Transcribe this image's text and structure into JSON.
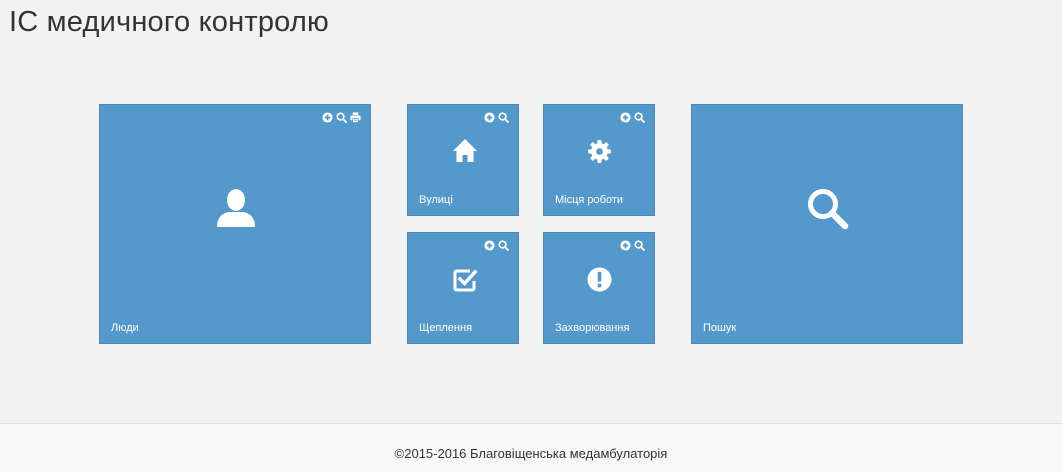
{
  "page": {
    "title": "ІС медичного контролю"
  },
  "tiles": {
    "people": {
      "label": "Люди",
      "icon": "user-icon"
    },
    "streets": {
      "label": "Вулиці",
      "icon": "home-icon"
    },
    "workplaces": {
      "label": "Місця роботи",
      "icon": "gear-icon"
    },
    "vaccinations": {
      "label": "Щеплення",
      "icon": "checkbox-icon"
    },
    "diseases": {
      "label": "Захворювання",
      "icon": "exclamation-icon"
    },
    "search": {
      "label": "Пошук",
      "icon": "search-icon"
    }
  },
  "colors": {
    "tile": "#5599cc",
    "background": "#f2f2f2",
    "footer": "#f8f8f8"
  },
  "footer": {
    "text": "©2015-2016 Благовіщенська медамбулаторія"
  }
}
